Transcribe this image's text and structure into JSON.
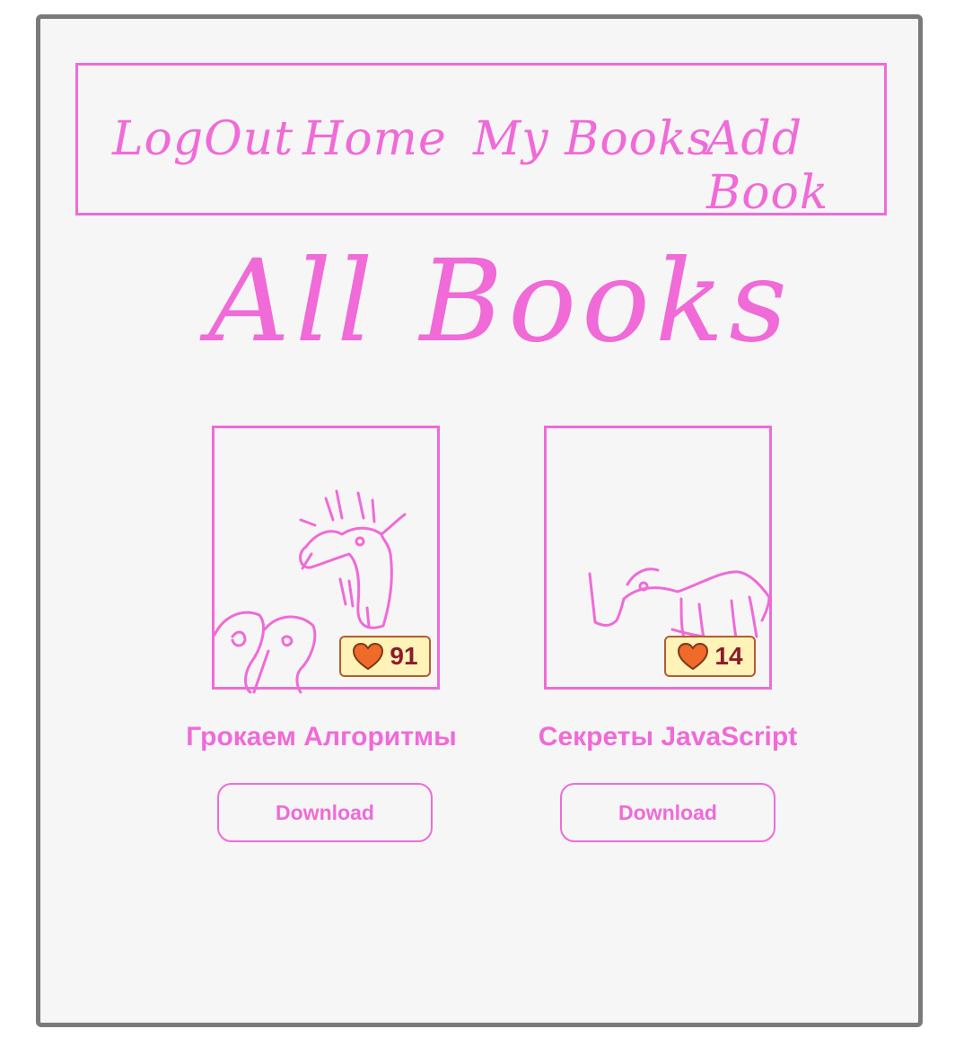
{
  "nav": {
    "items": [
      {
        "label": "LogOut"
      },
      {
        "label": "Home"
      },
      {
        "label": "My Books"
      },
      {
        "label": "Add Book"
      }
    ]
  },
  "page": {
    "title": "All Books"
  },
  "books": [
    {
      "title": "Грокаем Алгоритмы",
      "likes": "91",
      "download_label": "Download",
      "cover_icon": "goat-and-mice-illustration"
    },
    {
      "title": "Секреты JavaScript",
      "likes": "14",
      "download_label": "Download",
      "cover_icon": "rhino-illustration"
    }
  ],
  "colors": {
    "accent": "#f06ad8",
    "frame": "#7a7a7a",
    "badge_bg": "#fff3b8",
    "heart": "#f06a2a"
  }
}
